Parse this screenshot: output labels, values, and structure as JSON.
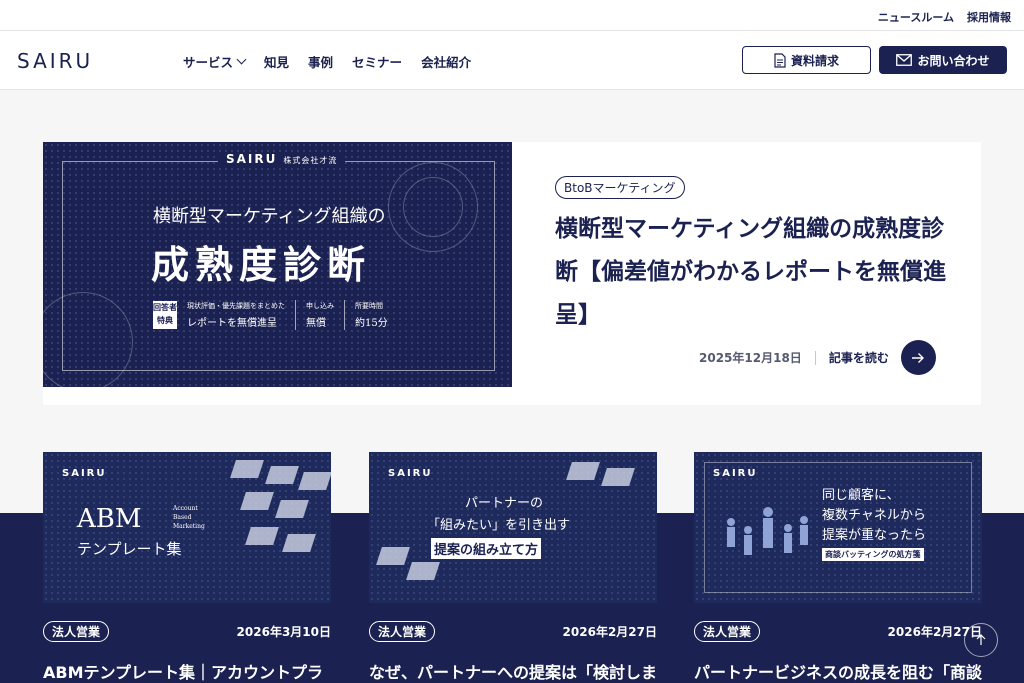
{
  "topbar": {
    "news": "ニュースルーム",
    "recruit": "採用情報"
  },
  "header": {
    "logo": "SAIRU",
    "nav": [
      "サービス",
      "知見",
      "事例",
      "セミナー",
      "会社紹介"
    ],
    "doc_button": "資料請求",
    "contact_button": "お問い合わせ"
  },
  "feature": {
    "image": {
      "logo": "SAIRU",
      "company": "株式会社才流",
      "line1": "横断型マーケティング組織の",
      "line2": "成熟度診断",
      "badge": "回答者特典",
      "note_small": "現状評価・優先課題をまとめた",
      "note_main": "レポートを無償進呈",
      "apply_small": "申し込み",
      "apply_main": "無償",
      "time_small": "所要時間",
      "time_main": "約15分"
    },
    "tag": "BtoBマーケティング",
    "title": "横断型マーケティング組織の成熟度診断【偏差値がわかるレポートを無償進呈】",
    "date": "2025年12月18日",
    "read_more": "記事を読む"
  },
  "cards": [
    {
      "image_logo": "SAIRU",
      "image_title": "ABM",
      "image_sub": "テンプレート集",
      "image_note": "Account Based Marketing",
      "tag": "法人営業",
      "date": "2026年3月10日",
      "title": "ABMテンプレート集｜アカウントプラ"
    },
    {
      "image_logo": "SAIRU",
      "image_title": "パートナーの",
      "image_sub": "「組みたい」を引き出す",
      "image_note": "提案の組み立て方",
      "tag": "法人営業",
      "date": "2026年2月27日",
      "title": "なぜ、パートナーへの提案は「検討しま"
    },
    {
      "image_logo": "SAIRU",
      "image_title": "同じ顧客に、",
      "image_sub": "複数チャネルから",
      "image_note": "提案が重なったら",
      "image_note2": "商談バッティングの処方箋",
      "tag": "法人営業",
      "date": "2026年2月27日",
      "title": "パートナービジネスの成長を阻む「商談"
    }
  ],
  "icons": {
    "document": "document-icon",
    "mail": "mail-icon",
    "arrow": "arrow-right-icon",
    "up": "arrow-up-icon"
  },
  "colors": {
    "navy": "#1b2150",
    "background": "#f6f6f7"
  }
}
